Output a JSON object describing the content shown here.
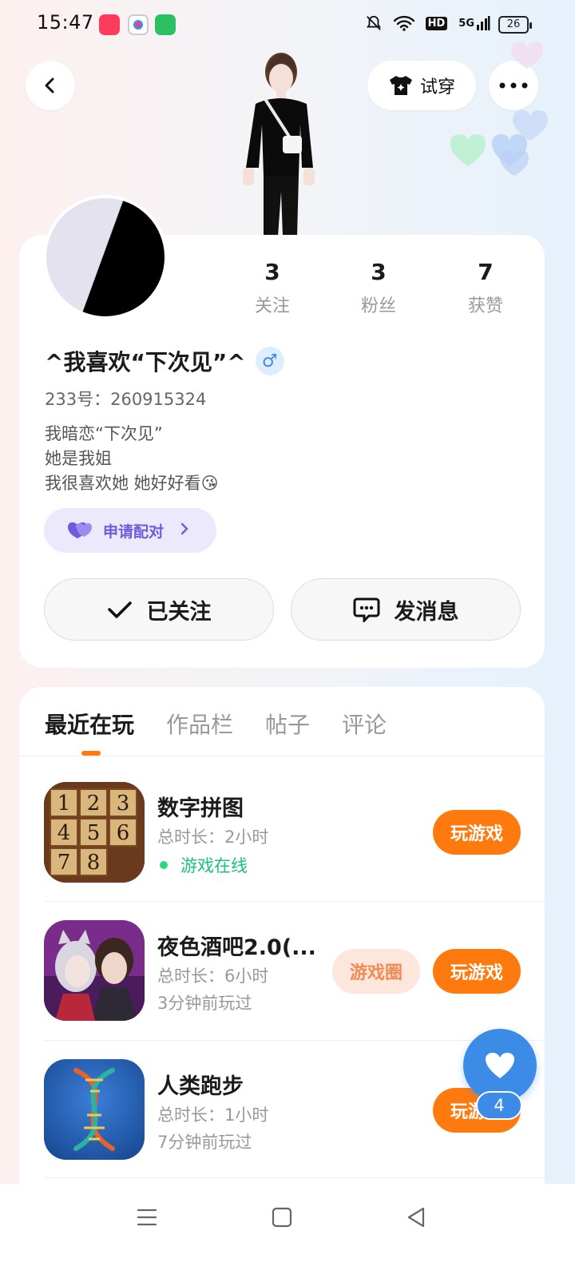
{
  "status_bar": {
    "time": "15:47",
    "network": "5G",
    "hd_label": "HD",
    "battery": "26"
  },
  "header": {
    "try_on_label": "试穿"
  },
  "profile": {
    "stats": [
      {
        "value": "3",
        "label": "关注"
      },
      {
        "value": "3",
        "label": "粉丝"
      },
      {
        "value": "7",
        "label": "获赞"
      }
    ],
    "nickname": "^我喜欢“下次见”^",
    "gender_symbol": "♂",
    "id_label": "233号：",
    "id_value": "260915324",
    "bio": [
      "我暗恋“下次见”",
      "她是我姐",
      "我很喜欢她  她好好看😘"
    ],
    "pair_label": "申请配对",
    "follow_label": "已关注",
    "message_label": "发消息"
  },
  "tabs": [
    {
      "label": "最近在玩",
      "active": true
    },
    {
      "label": "作品栏",
      "active": false
    },
    {
      "label": "帖子",
      "active": false
    },
    {
      "label": "评论",
      "active": false
    }
  ],
  "games": [
    {
      "title": "数字拼图",
      "duration": "总时长：2小时",
      "status": "游戏在线",
      "online": true,
      "play_label": "玩游戏"
    },
    {
      "title": "夜色酒吧2.0(...",
      "duration": "总时长：6小时",
      "status": "3分钟前玩过",
      "online": false,
      "circle_label": "游戏圈",
      "play_label": "玩游戏"
    },
    {
      "title": "人类跑步",
      "duration": "总时长：1小时",
      "status": "7分钟前玩过",
      "online": false,
      "play_label": "玩游戏"
    }
  ],
  "puzzle_tiles": [
    "1",
    "2",
    "3",
    "4",
    "5",
    "6",
    "7",
    "8"
  ],
  "float_like": {
    "count": "4"
  },
  "colors": {
    "accent_orange": "#ff7a0e",
    "accent_blue": "#3c8ce7",
    "pair_purple": "#6e5cdf",
    "online_green": "#1bc27a"
  }
}
